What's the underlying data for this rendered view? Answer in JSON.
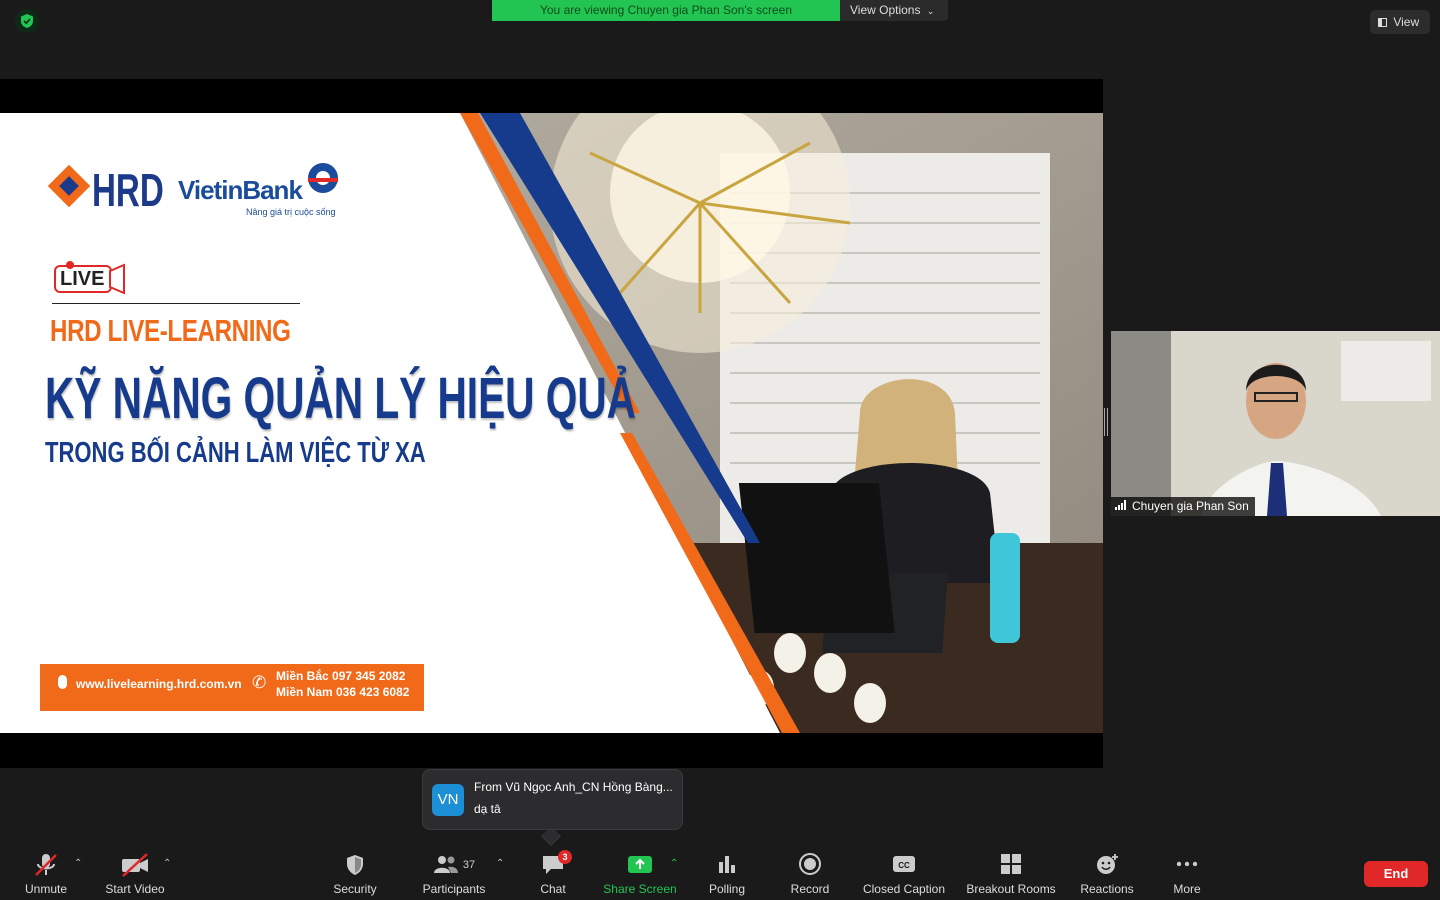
{
  "top": {
    "banner": "You are viewing Chuyen gia Phan Son's screen",
    "view_options": "View Options",
    "view_button": "View"
  },
  "slide": {
    "logo_hrd": "HRD",
    "logo_bank": "VietinBank",
    "bank_tagline": "Nâng giá trị cuộc sống",
    "live_badge": "LIVE",
    "subtitle": "HRD LIVE-LEARNING",
    "title": "KỸ NĂNG QUẢN LÝ HIỆU QUẢ",
    "title2": "TRONG BỐI CẢNH LÀM VIỆC TỪ XA",
    "url": "www.livelearning.hrd.com.vn",
    "phone_north": "Miền Bắc 097 345 2082",
    "phone_south": "Miền Nam 036 423 6082",
    "accent_orange": "#f06a1a",
    "accent_blue": "#163a8c"
  },
  "thumbnail": {
    "name": "Chuyen gia Phan Son"
  },
  "chat_popup": {
    "avatar": "VN",
    "from": "From Vũ Ngọc Anh_CN Hồng Bàng...",
    "message": "dạ tâ"
  },
  "toolbar": {
    "unmute": "Unmute",
    "start_video": "Start Video",
    "security": "Security",
    "participants": "Participants",
    "participants_count": "37",
    "chat": "Chat",
    "chat_badge": "3",
    "share_screen": "Share Screen",
    "polling": "Polling",
    "record": "Record",
    "closed_caption": "Closed Caption",
    "breakout_rooms": "Breakout Rooms",
    "reactions": "Reactions",
    "more": "More",
    "end": "End"
  }
}
